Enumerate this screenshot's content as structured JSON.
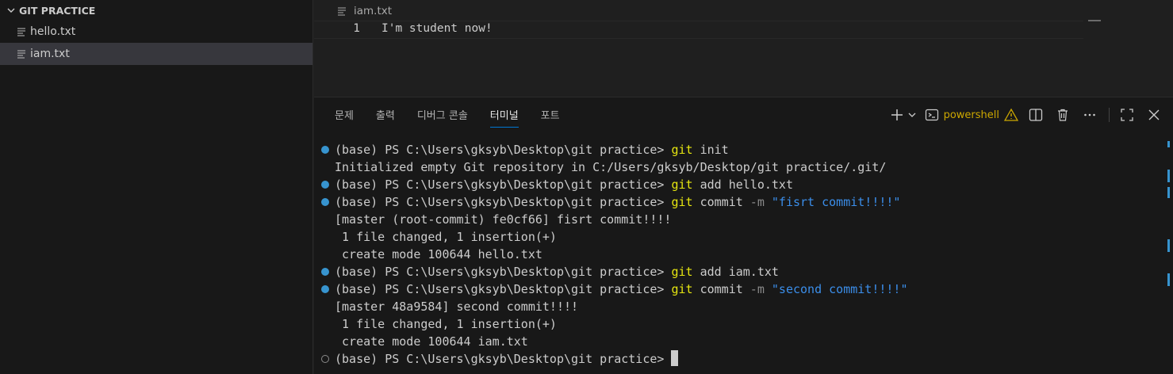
{
  "sidebar": {
    "folder_title": "GIT PRACTICE",
    "files": [
      {
        "name": "hello.txt",
        "active": false
      },
      {
        "name": "iam.txt",
        "active": true
      }
    ]
  },
  "editor": {
    "breadcrumb_file": "iam.txt",
    "lines": [
      {
        "number": "1",
        "text": "I'm student now!"
      }
    ]
  },
  "panel": {
    "tabs": [
      {
        "label": "문제",
        "active": false
      },
      {
        "label": "출력",
        "active": false
      },
      {
        "label": "디버그 콘솔",
        "active": false
      },
      {
        "label": "터미널",
        "active": true
      },
      {
        "label": "포트",
        "active": false
      }
    ],
    "shell_name": "powershell",
    "accent_color": "#0078d4",
    "warning_color": "#cca700"
  },
  "terminal": {
    "prompt": "(base) PS C:\\Users\\gksyb\\Desktop\\git practice> ",
    "lines": [
      {
        "kind": "cmd",
        "deco": "ok",
        "cmd": "git",
        "args": " init",
        "flag": "",
        "str": ""
      },
      {
        "kind": "out",
        "text": "Initialized empty Git repository in C:/Users/gksyb/Desktop/git practice/.git/"
      },
      {
        "kind": "cmd",
        "deco": "ok",
        "cmd": "git",
        "args": " add hello.txt",
        "flag": "",
        "str": ""
      },
      {
        "kind": "cmd",
        "deco": "ok",
        "cmd": "git",
        "args": " commit ",
        "flag": "-m",
        "str": " \"fisrt commit!!!!\""
      },
      {
        "kind": "out",
        "text": "[master (root-commit) fe0cf66] fisrt commit!!!!"
      },
      {
        "kind": "out",
        "text": " 1 file changed, 1 insertion(+)"
      },
      {
        "kind": "out",
        "text": " create mode 100644 hello.txt"
      },
      {
        "kind": "cmd",
        "deco": "ok",
        "cmd": "git",
        "args": " add iam.txt",
        "flag": "",
        "str": ""
      },
      {
        "kind": "cmd",
        "deco": "ok",
        "cmd": "git",
        "args": " commit ",
        "flag": "-m",
        "str": " \"second commit!!!!\""
      },
      {
        "kind": "out",
        "text": "[master 48a9584] second commit!!!!"
      },
      {
        "kind": "out",
        "text": " 1 file changed, 1 insertion(+)"
      },
      {
        "kind": "out",
        "text": " create mode 100644 iam.txt"
      },
      {
        "kind": "cmd",
        "deco": "empty",
        "cmd": "",
        "args": "",
        "flag": "",
        "str": "",
        "cursor": true
      }
    ]
  }
}
